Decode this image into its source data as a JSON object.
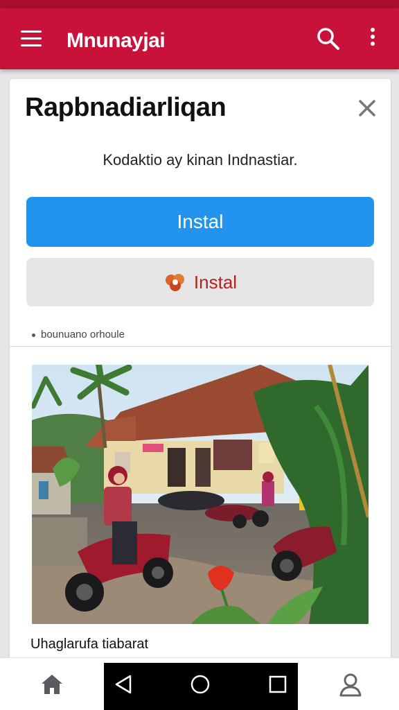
{
  "app_bar": {
    "title": "Mnunayjai",
    "color": "#c8123a",
    "icons": [
      "menu-icon",
      "search-icon",
      "more-vert-icon"
    ]
  },
  "dialog": {
    "title": "Rapbnadiarliqan",
    "description": "Kodaktio ay kinan Indnastiar.",
    "primary_button": "Instal",
    "secondary_button": "Instal",
    "note": "bounuano orhoule",
    "primary_color": "#2294ee",
    "secondary_text_color": "#b5211f"
  },
  "photo": {
    "caption": "Uhaglarufa tiabarat"
  },
  "bottom_nav": {
    "icons": [
      "home-icon",
      "profile-icon"
    ]
  },
  "system_nav": {
    "icons": [
      "back-icon",
      "home-circle-icon",
      "recents-icon"
    ]
  }
}
